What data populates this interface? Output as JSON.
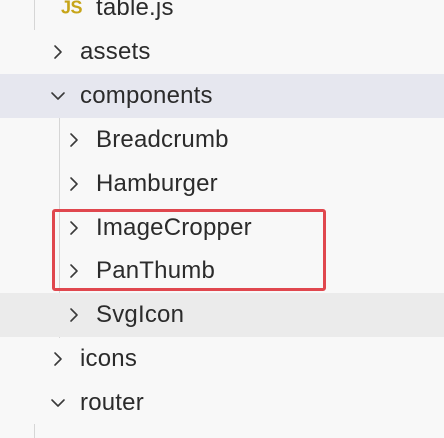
{
  "explorer": {
    "items": [
      {
        "label": "table.js",
        "kind": "file",
        "icon": "js-file-icon",
        "icon_text": "JS"
      },
      {
        "label": "assets",
        "kind": "folder",
        "expanded": false
      },
      {
        "label": "components",
        "kind": "folder",
        "expanded": true
      },
      {
        "label": "Breadcrumb",
        "kind": "folder",
        "expanded": false
      },
      {
        "label": "Hamburger",
        "kind": "folder",
        "expanded": false
      },
      {
        "label": "ImageCropper",
        "kind": "folder",
        "expanded": false
      },
      {
        "label": "PanThumb",
        "kind": "folder",
        "expanded": false
      },
      {
        "label": "SvgIcon",
        "kind": "folder",
        "expanded": false
      },
      {
        "label": "icons",
        "kind": "folder",
        "expanded": false
      },
      {
        "label": "router",
        "kind": "folder",
        "expanded": true
      }
    ]
  },
  "colors": {
    "selected_row": "#e6e7ef",
    "hover_row": "#ebebeb",
    "highlight_border": "#e0474e",
    "js_icon": "#c7a51a"
  }
}
